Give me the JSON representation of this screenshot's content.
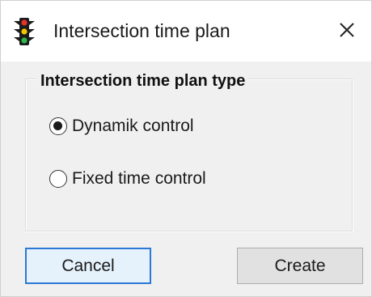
{
  "window": {
    "title": "Intersection time plan",
    "app_icon": "traffic-light-icon",
    "close_icon": "close-icon"
  },
  "group": {
    "legend": "Intersection time plan type",
    "options": [
      {
        "label": "Dynamik control",
        "selected": true
      },
      {
        "label": "Fixed time control",
        "selected": false
      }
    ]
  },
  "buttons": {
    "cancel_label": "Cancel",
    "create_label": "Create"
  },
  "colors": {
    "focus_border": "#2b78d6",
    "dialog_background": "#f0f0f0"
  }
}
